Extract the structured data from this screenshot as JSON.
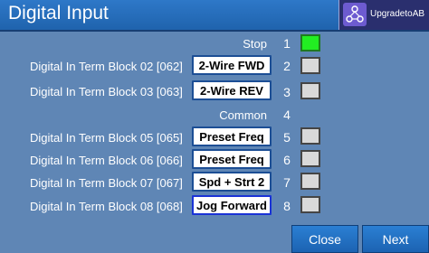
{
  "header": {
    "title": "Digital Input",
    "brand_label": "UpgradetoAB",
    "brand_icon": "connected-nodes-icon"
  },
  "rows": {
    "stop": {
      "label": "Stop",
      "number": "1",
      "state": "on"
    },
    "r2": {
      "label": "Digital In Term Block 02 [062]",
      "function": "2-Wire FWD",
      "number": "2",
      "state": "off"
    },
    "r3": {
      "label": "Digital In Term Block 03 [063]",
      "function": "2-Wire REV",
      "number": "3",
      "state": "off"
    },
    "common": {
      "label": "Common",
      "number": "4"
    },
    "r5": {
      "label": "Digital In Term Block 05 [065]",
      "function": "Preset Freq",
      "number": "5",
      "state": "off"
    },
    "r6": {
      "label": "Digital In Term Block 06 [066]",
      "function": "Preset Freq",
      "number": "6",
      "state": "off"
    },
    "r7": {
      "label": "Digital In Term Block 07 [067]",
      "function": "Spd + Strt 2",
      "number": "7",
      "state": "off"
    },
    "r8": {
      "label": "Digital In Term Block 08 [068]",
      "function": "Jog Forward",
      "number": "8",
      "state": "off"
    }
  },
  "footer": {
    "close_label": "Close",
    "next_label": "Next"
  },
  "colors": {
    "background": "#5f86b5",
    "indicator_on": "#22ee22",
    "indicator_off": "#d9d9d9"
  }
}
